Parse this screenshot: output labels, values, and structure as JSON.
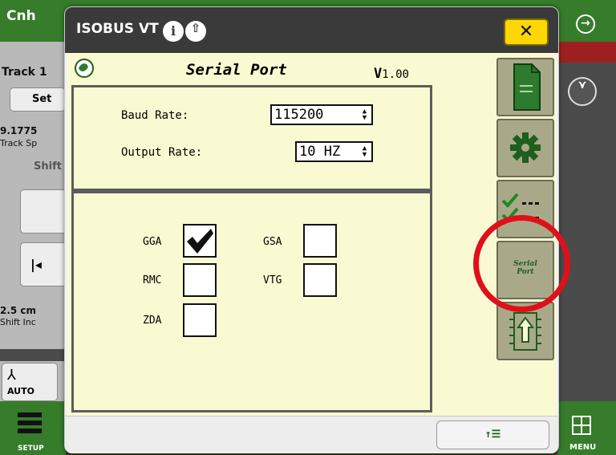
{
  "background": {
    "top_title": "Cnh",
    "left_panel": {
      "track": "Track 1",
      "set_button": "Set",
      "value_number": "9.1775",
      "value_label": "Track Sp",
      "shift_label": "Shift",
      "shift_value": "2.5 cm",
      "shift_caption": "Shift Inc",
      "auto_label": "AUTO"
    },
    "bottom_left_label": "SETUP",
    "bottom_right_label": "MENU"
  },
  "dialog": {
    "title": "ISOBUS VT",
    "close_label": "✕",
    "vt": {
      "title": "Serial Port",
      "version_prefix": "V",
      "version_number": "1.00",
      "baud_rate_label": "Baud Rate:",
      "baud_rate_value": "115200",
      "output_rate_label": "Output Rate:",
      "output_rate_value": "10 HZ",
      "messages": [
        {
          "label": "GGA",
          "checked": true
        },
        {
          "label": "GSA",
          "checked": false
        },
        {
          "label": "RMC",
          "checked": false
        },
        {
          "label": "VTG",
          "checked": false
        },
        {
          "label": "ZDA",
          "checked": false
        }
      ],
      "softkeys": {
        "serial_port_line1": "Serial",
        "serial_port_line2": "Port"
      }
    },
    "nav_button_label": "↑☰"
  },
  "colors": {
    "vt_background": "#fafad2",
    "softkey": "#a9a989",
    "accent_green": "#367c2b",
    "close_yellow": "#ffd700",
    "highlight_red": "#e0101a"
  }
}
